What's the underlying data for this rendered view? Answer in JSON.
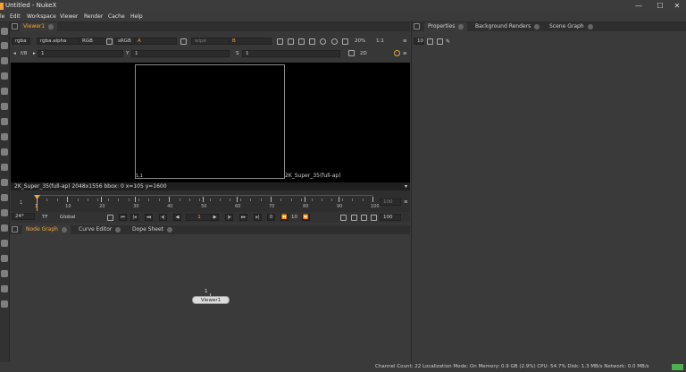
{
  "window": {
    "title": "Untitled - NukeX",
    "minimize": "—",
    "maximize": "☐",
    "close": "✕"
  },
  "menu": [
    "le",
    "Edit",
    "Workspace",
    "Viewer",
    "Render",
    "Cache",
    "Help"
  ],
  "viewer": {
    "tab": "Viewer1",
    "row1": {
      "channels": "rgba",
      "alpha": "rgba.alpha",
      "colorspace": "RGB",
      "lut": "sRGB",
      "input_a": "A",
      "wipe": "wipe",
      "input_b": "B",
      "zoom": "20%",
      "ratio": "1:1"
    },
    "row2": {
      "fstop": "f/8",
      "gain": "1",
      "gamma_label": "Y",
      "gamma": "1",
      "sat_label": "S",
      "sat": "1",
      "view_mode": "2D"
    },
    "status": "2K_Super_35(full-ap) 2048x1556  bbox: 0  x=105 y=1600",
    "format_label": "2K_Super_35(full-ap)",
    "corner_label": "1,1"
  },
  "timeline": {
    "ticks": [
      "1",
      "10",
      "20",
      "30",
      "40",
      "50",
      "60",
      "70",
      "80",
      "90",
      "100"
    ],
    "start": "1",
    "end_field": "100",
    "current_frame": "1",
    "fps": "24*",
    "tf": "TF",
    "range_mode": "Global",
    "increment": "10",
    "out_frame": "100",
    "loop": "0"
  },
  "node_graph": {
    "tabs": [
      "Node Graph",
      "Curve Editor",
      "Dope Sheet"
    ],
    "node_label": "Viewer1",
    "node_input": "1"
  },
  "properties": {
    "tabs": [
      "Properties",
      "Background Renders",
      "Scene Graph"
    ],
    "max_panels": "10"
  },
  "statusbar": "Channel Count: 22  Localization Mode: On  Memory: 0.9 GB (2.9%)  CPU: 54.7%  Disk: 1.3 MB/s  Network: 0.0 MB/s",
  "colors": {
    "accent": "#f2a33a",
    "bg": "#3a3a3a",
    "viewer_bg": "#000000"
  }
}
